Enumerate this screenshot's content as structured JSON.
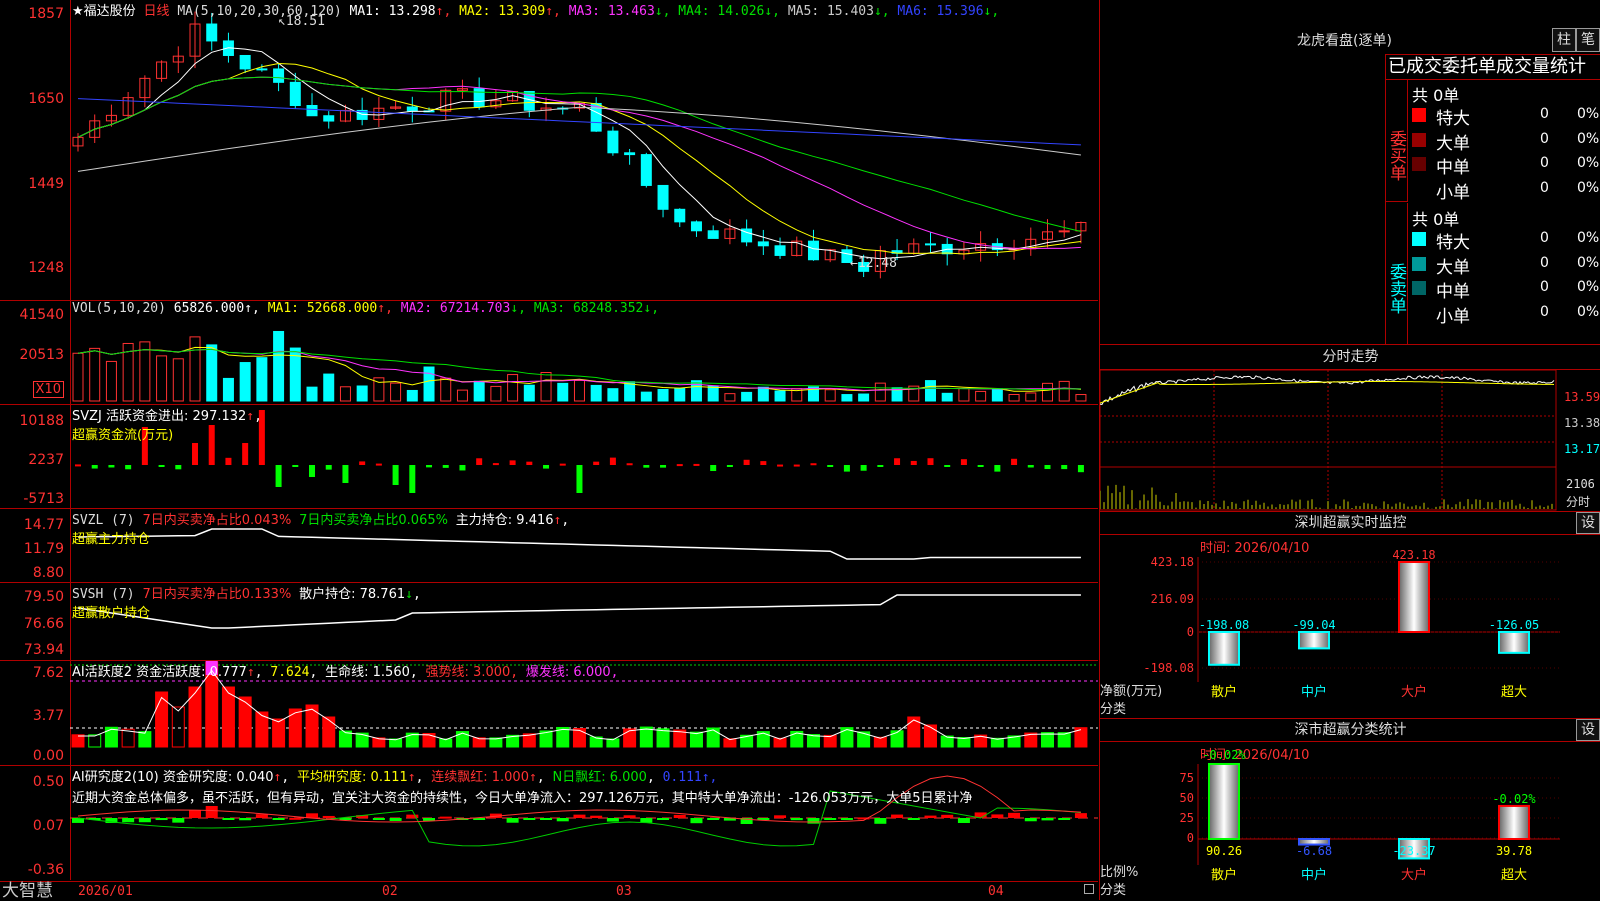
{
  "stock": {
    "name": "★福达股份",
    "period": "日线",
    "ma_header": "MA(5,10,20,30,60,120)",
    "ma": [
      {
        "label": "MA1: 13.298",
        "arrow": "↑",
        "color": "#ffffff"
      },
      {
        "label": "MA2: 13.309",
        "arrow": "↑",
        "color": "#ffff00"
      },
      {
        "label": "MA3: 13.463",
        "arrow": "↓",
        "color": "#ff33ff"
      },
      {
        "label": "MA4: 14.026",
        "arrow": "↓",
        "color": "#00e000"
      },
      {
        "label": "MA5: 15.403",
        "arrow": "↓",
        "color": "#cccccc"
      },
      {
        "label": "MA6: 15.396",
        "arrow": "↓",
        "color": "#3344ff"
      }
    ],
    "high_mark": "18.51",
    "low_mark": "12.48",
    "y_ticks": [
      "1857",
      "1650",
      "1449",
      "1248"
    ]
  },
  "vol": {
    "header": "VOL(5,10,20)",
    "value": "65826.000",
    "ma": [
      {
        "label": "MA1: 52668.000",
        "arrow": "↑",
        "color": "#ffff00"
      },
      {
        "label": "MA2: 67214.703",
        "arrow": "↓",
        "color": "#ff33ff"
      },
      {
        "label": "MA3: 68248.352",
        "arrow": "↓",
        "color": "#00e000"
      }
    ],
    "y_ticks": [
      "41540",
      "20513"
    ],
    "unit": "X10"
  },
  "svzj": {
    "header": "SVZJ  活跃资金进出: 297.132",
    "arrow": "↑",
    "sub": "超赢资金流(万元)",
    "y_ticks": [
      "10188",
      "2237",
      "-5713"
    ]
  },
  "svzl": {
    "header1": "SVZL (7)",
    "red": "7日内买卖净占比0.043%",
    "green": "7日内买卖净占比0.065%",
    "white": "主力持仓: 9.416",
    "sub": "超赢主力持仓",
    "y_ticks": [
      "14.77",
      "11.79",
      "8.80"
    ]
  },
  "svsh": {
    "header1": "SVSH (7)",
    "red": "7日内买卖净占比0.133%",
    "white": "散户持仓: 78.761",
    "sub": "超赢散户持仓",
    "y_ticks": [
      "79.50",
      "76.66",
      "73.94"
    ]
  },
  "ai1": {
    "header": "AI活跃度2 资金活跃度: 0.777",
    "v2": "7.624",
    "life": "生命线: 1.560",
    "strong": "强势线: 3.000",
    "burst": "爆发线: 6.000",
    "y_ticks": [
      "7.62",
      "3.77",
      "0.00"
    ]
  },
  "ai2": {
    "header": "AI研究度2(10) 资金研究度: 0.040",
    "avg": "平均研究度: 0.111",
    "cont": "连续飘红: 1.000",
    "nday": "N日飘红: 6.000",
    "last": "0.111",
    "comment": "近期大资金总体偏多，虽不活跃，但有异动，宜关注大资金的持续性，今日大单净流入：297.126万元，其中特大单净流出：-126.053万元，大单5日累计净",
    "y_ticks": [
      "0.50",
      "0.07",
      "-0.36"
    ]
  },
  "xaxis": {
    "brand": "大智慧",
    "dates": [
      "2026/01",
      "02",
      "03",
      "04"
    ]
  },
  "dragon": {
    "title": "龙虎看盘(逐单)",
    "btn1": "柱",
    "btn2": "笔",
    "subtitle": "已成交委托单成交量统计",
    "buy_label": "委买单",
    "sell_label": "委卖单",
    "buy_total": "共 0单",
    "sell_total": "共 0单",
    "buy_rows": [
      {
        "name": "特大",
        "count": "0",
        "pct": "0%",
        "color": "#ff0000"
      },
      {
        "name": "大单",
        "count": "0",
        "pct": "0%",
        "color": "#990000"
      },
      {
        "name": "中单",
        "count": "0",
        "pct": "0%",
        "color": "#660000"
      },
      {
        "name": "小单",
        "count": "0",
        "pct": "0%",
        "color": "#000000"
      }
    ],
    "sell_rows": [
      {
        "name": "特大",
        "count": "0",
        "pct": "0%",
        "color": "#00ffff"
      },
      {
        "name": "大单",
        "count": "0",
        "pct": "0%",
        "color": "#009999"
      },
      {
        "name": "中单",
        "count": "0",
        "pct": "0%",
        "color": "#006666"
      },
      {
        "name": "小单",
        "count": "0",
        "pct": "0%",
        "color": "#000000"
      }
    ]
  },
  "intraday": {
    "title": "分时走势",
    "prices": [
      "13.59",
      "13.38",
      "13.17"
    ],
    "vol_label": "2106",
    "unit": "分时"
  },
  "sz_monitor": {
    "title": "深圳超赢实时监控",
    "settings": "设",
    "time": "时间: 2026/04/10",
    "y_ticks": [
      "423.18",
      "216.09",
      "0",
      "-198.08"
    ],
    "ylabel": "净额(万元)",
    "xlabel": "分类",
    "bars": [
      {
        "cat": "散户",
        "value": "-198.08",
        "v": -198.08
      },
      {
        "cat": "中户",
        "value": "-99.04",
        "v": -99.04
      },
      {
        "cat": "大户",
        "value": "423.18",
        "v": 423.18
      },
      {
        "cat": "超大",
        "value": "-126.05",
        "v": -126.05
      }
    ]
  },
  "sz_class": {
    "title": "深市超赢分类统计",
    "settings": "设",
    "time": "时间: 2026/04/10",
    "y_ticks": [
      "75",
      "50",
      "25",
      "0"
    ],
    "ylabel": "比例%",
    "xlabel": "分类",
    "top_labels": [
      "-0.02%",
      "-0.02%"
    ],
    "bars": [
      {
        "cat": "散户",
        "value": "90.26",
        "v": 90.26
      },
      {
        "cat": "中户",
        "value": "-6.68",
        "v": -6.68
      },
      {
        "cat": "大户",
        "value": "-23.37",
        "v": -23.37
      },
      {
        "cat": "超大",
        "value": "39.78",
        "v": 39.78
      }
    ]
  }
}
